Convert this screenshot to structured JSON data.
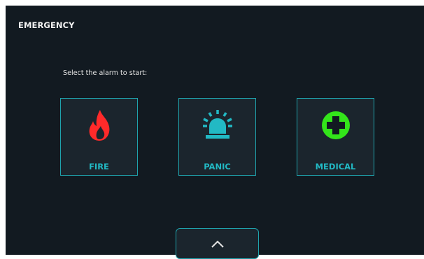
{
  "header": {
    "title": "EMERGENCY"
  },
  "prompt": "Select the alarm to start:",
  "alarms": [
    {
      "label": "FIRE",
      "icon": "fire-icon",
      "color": "#ff2a2a"
    },
    {
      "label": "PANIC",
      "icon": "siren-icon",
      "color": "#22b9c4"
    },
    {
      "label": "MEDICAL",
      "icon": "medical-cross-icon",
      "color": "#33e51a"
    }
  ],
  "footer": {
    "icon": "chevron-up-icon"
  },
  "colors": {
    "background": "#121a21",
    "tile": "#1b252d",
    "accent": "#1fa3ad"
  }
}
